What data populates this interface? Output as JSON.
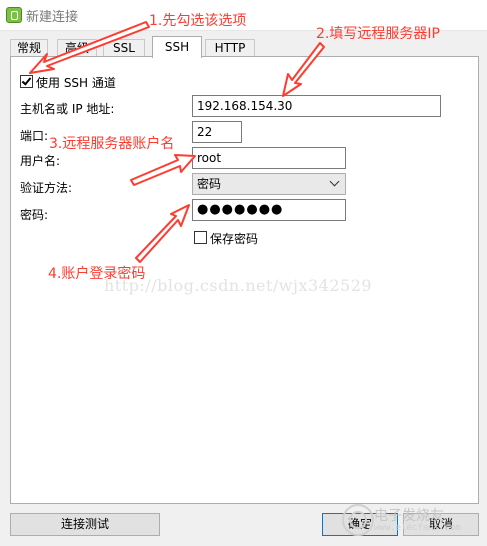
{
  "window": {
    "title": "新建连接"
  },
  "tabs": [
    {
      "label": "常规",
      "active": false
    },
    {
      "label": "高级",
      "active": false
    },
    {
      "label": "SSL",
      "active": false
    },
    {
      "label": "SSH",
      "active": true
    },
    {
      "label": "HTTP",
      "active": false
    }
  ],
  "form": {
    "use_ssh_label": "使用 SSH 通道",
    "use_ssh_checked": true,
    "host_label": "主机名或 IP 地址:",
    "host_value": "192.168.154.30",
    "port_label": "端口:",
    "port_value": "22",
    "username_label": "用户名:",
    "username_value": "root",
    "auth_label": "验证方法:",
    "auth_value": "密码",
    "password_label": "密码:",
    "password_value": "●●●●●●●",
    "save_password_label": "保存密码",
    "save_password_checked": false
  },
  "buttons": {
    "test_connection": "连接测试",
    "ok": "确定",
    "cancel": "取消"
  },
  "annotations": {
    "step1": "1.先勾选该选项",
    "step2": "2.填写远程服务器IP",
    "step3": "3.远程服务器账户名",
    "step4": "4.账户登录密码",
    "color": "#ff3b2f"
  },
  "watermark": "http://blog.csdn.net/wjx342529",
  "corner_logo": {
    "text": "电子发烧友",
    "sub": "www.elecfans.com"
  }
}
